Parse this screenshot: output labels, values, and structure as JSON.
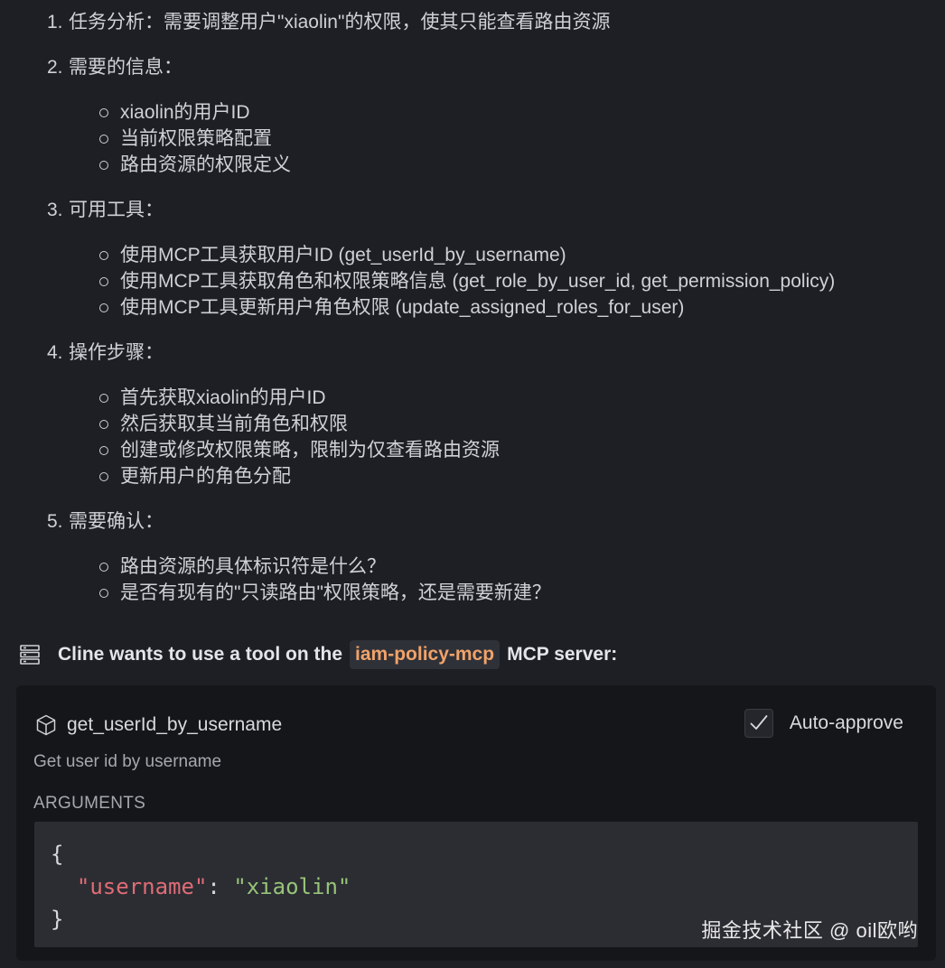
{
  "steps": [
    {
      "num": "1.",
      "title": "任务分析：需要调整用户\"xiaolin\"的权限，使其只能查看路由资源",
      "items": []
    },
    {
      "num": "2.",
      "title": "需要的信息：",
      "items": [
        "xiaolin的用户ID",
        "当前权限策略配置",
        "路由资源的权限定义"
      ]
    },
    {
      "num": "3.",
      "title": "可用工具：",
      "items": [
        "使用MCP工具获取用户ID (get_userId_by_username)",
        "使用MCP工具获取角色和权限策略信息 (get_role_by_user_id, get_permission_policy)",
        "使用MCP工具更新用户角色权限 (update_assigned_roles_for_user)"
      ]
    },
    {
      "num": "4.",
      "title": "操作步骤：",
      "items": [
        "首先获取xiaolin的用户ID",
        "然后获取其当前角色和权限",
        "创建或修改权限策略，限制为仅查看路由资源",
        "更新用户的角色分配"
      ]
    },
    {
      "num": "5.",
      "title": "需要确认：",
      "items": [
        "路由资源的具体标识符是什么？",
        "是否有现有的\"只读路由\"权限策略，还是需要新建？"
      ]
    }
  ],
  "tool_header": {
    "icon": "server-icon",
    "prefix": "Cline wants to use a tool on the",
    "server_name": "iam-policy-mcp",
    "suffix": "MCP server:"
  },
  "tool": {
    "icon": "cube-icon",
    "name": "get_userId_by_username",
    "auto_approve_label": "Auto-approve",
    "auto_approve_checked": true,
    "description": "Get user id by username",
    "arguments_label": "ARGUMENTS",
    "arguments": {
      "open_brace": "{",
      "key": "\"username\"",
      "colon": ": ",
      "value": "\"xiaolin\"",
      "close_brace": "}"
    }
  },
  "watermark": "掘金技术社区 @ oil欧哟",
  "colors": {
    "background": "#1e1f24",
    "card": "#15161a",
    "code_bg": "#2b2d33",
    "server_name": "#f0a36a",
    "json_key": "#e06c75",
    "json_string": "#98c379"
  }
}
